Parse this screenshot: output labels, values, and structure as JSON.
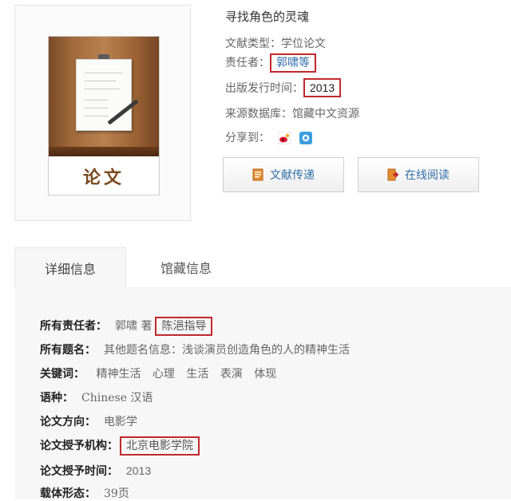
{
  "record": {
    "cover_label": "论文",
    "title": "寻找角色的灵魂",
    "doc_type_label": "文献类型：",
    "doc_type": "学位论文",
    "author_label": "责任者：",
    "author": "郭啸等",
    "pub_time_label": "出版发行时间：",
    "pub_time": "2013",
    "source_label": "来源数据库：",
    "source": "馆藏中文资源",
    "share_label": "分享到："
  },
  "actions": {
    "deliver": "文献传递",
    "read_online": "在线阅读"
  },
  "tabs": [
    "详细信息",
    "馆藏信息"
  ],
  "details": {
    "authors_key": "所有责任者：",
    "authors_val": "郭啸 著",
    "advisor": "陈浥指导",
    "titles_key": "所有题名：",
    "titles_val": "其他题名信息：浅谈演员创造角色的人的精神生活",
    "keywords_key": "关键词：",
    "keywords": [
      "精神生活",
      "心理",
      "生活",
      "表演",
      "体现"
    ],
    "language_key": "语种：",
    "language_val": "Chinese 汉语",
    "direction_key": "论文方向：",
    "direction_val": "电影学",
    "institution_key": "论文授予机构：",
    "institution_val": "北京电影学院",
    "grant_time_key": "论文授予时间：",
    "grant_time_val": "2013",
    "carrier_key": "载体形态：",
    "carrier_val": "39页"
  },
  "colors": {
    "highlight_box": "#c0282d",
    "link": "#2f6ea8"
  },
  "icons": [
    "share-weibo-icon",
    "share-qzone-icon",
    "document-icon",
    "read-icon"
  ]
}
